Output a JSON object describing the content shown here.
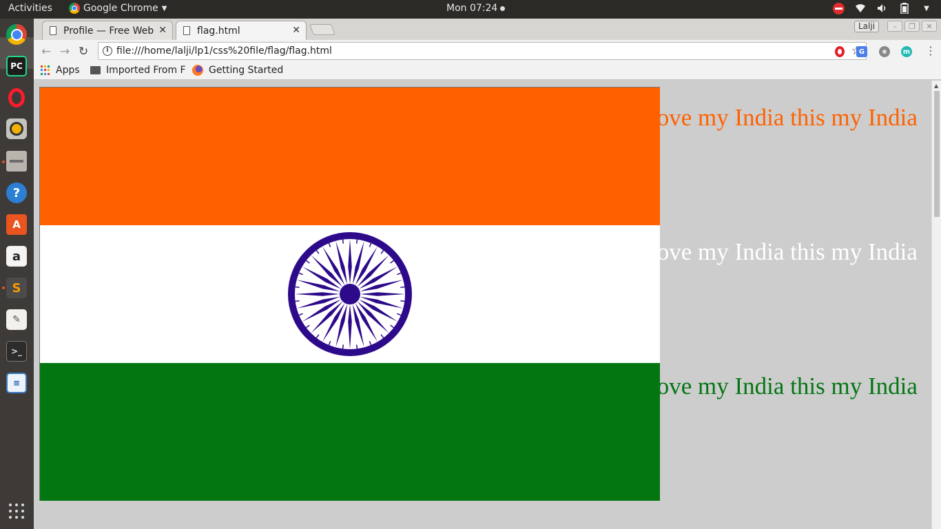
{
  "topbar": {
    "activities": "Activities",
    "app_name": "Google Chrome",
    "clock": "Mon 07:24"
  },
  "dock": {
    "items": [
      "Google Chrome",
      "PyCharm",
      "Opera",
      "Rhythmbox",
      "Files",
      "Help",
      "Ubuntu Software",
      "Amazon",
      "Sublime Text",
      "Text Editor",
      "Terminal",
      "LibreOffice Writer",
      "Show Applications"
    ],
    "pycharm_label": "PC",
    "help_glyph": "?",
    "store_glyph": "A",
    "amazon_glyph": "a",
    "sublime_glyph": "S",
    "terminal_glyph": ">_"
  },
  "browser": {
    "tabs": [
      {
        "title": "Profile — Free Web",
        "active": false
      },
      {
        "title": "flag.html",
        "active": true
      }
    ],
    "user_badge": "Lalji",
    "url": "file:///home/lalji/lp1/css%20file/flag/flag.html",
    "bookmarks": [
      {
        "label": "Apps",
        "icon": "apps-grid-icon"
      },
      {
        "label": "Imported From F",
        "icon": "folder-icon"
      },
      {
        "label": "Getting Started",
        "icon": "firefox-icon"
      }
    ]
  },
  "page": {
    "flag": {
      "saffron": "#ff6100",
      "white": "#ffffff",
      "green": "#037612",
      "chakra_color": "#2d0a8a",
      "spokes": 24
    },
    "lines": [
      {
        "text": "love my India this my India",
        "color": "#ff6100"
      },
      {
        "text": "love my India this my India",
        "color": "#ffffff"
      },
      {
        "text": "love my India this my India",
        "color": "#037612"
      }
    ]
  }
}
